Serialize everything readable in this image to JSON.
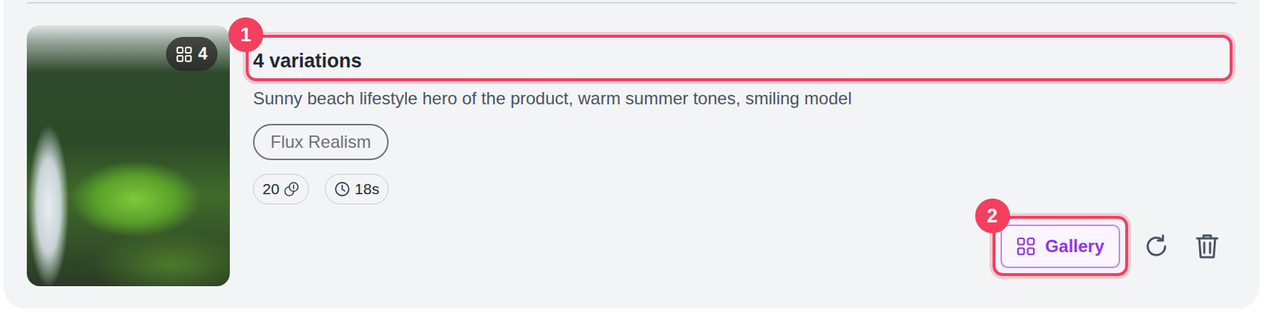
{
  "annotations": [
    {
      "label": "1"
    },
    {
      "label": "2"
    }
  ],
  "item": {
    "thumbnail": {
      "count": "4"
    },
    "title": "4 variations",
    "prompt": "Sunny beach lifestyle hero of the product, warm summer tones, smiling model",
    "model": "Flux Realism",
    "stats": [
      {
        "value": "20",
        "kind": "credits"
      },
      {
        "value": "18s",
        "kind": "time"
      }
    ],
    "gallery_button": "Gallery"
  }
}
